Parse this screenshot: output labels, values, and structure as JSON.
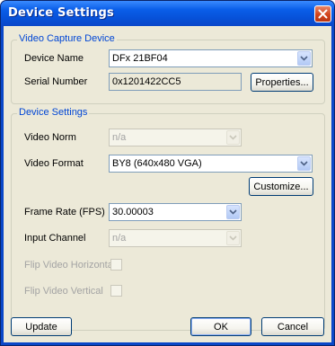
{
  "window": {
    "title": "Device Settings"
  },
  "capture_group": {
    "label": "Video Capture Device",
    "device_name_label": "Device Name",
    "device_name_value": "DFx 21BF04",
    "serial_label": "Serial Number",
    "serial_value": "0x1201422CC5",
    "properties_button": "Properties..."
  },
  "settings_group": {
    "label": "Device Settings",
    "video_norm_label": "Video Norm",
    "video_norm_value": "n/a",
    "video_format_label": "Video Format",
    "video_format_value": "BY8 (640x480 VGA)",
    "customize_button": "Customize...",
    "frame_rate_label": "Frame Rate (FPS)",
    "frame_rate_value": "30.00003",
    "input_channel_label": "Input Channel",
    "input_channel_value": "n/a",
    "flip_h_label": "Flip Video Horizontal",
    "flip_v_label": "Flip Video Vertical"
  },
  "footer": {
    "update_button": "Update",
    "ok_button": "OK",
    "cancel_button": "Cancel"
  },
  "colors": {
    "titlebar": "#0a5ee8",
    "group_label": "#0046d5",
    "dialog_background": "#ece9d8",
    "close_button": "#d2431b"
  },
  "icons": {
    "close": "close-icon",
    "dropdown": "chevron-down-icon"
  }
}
